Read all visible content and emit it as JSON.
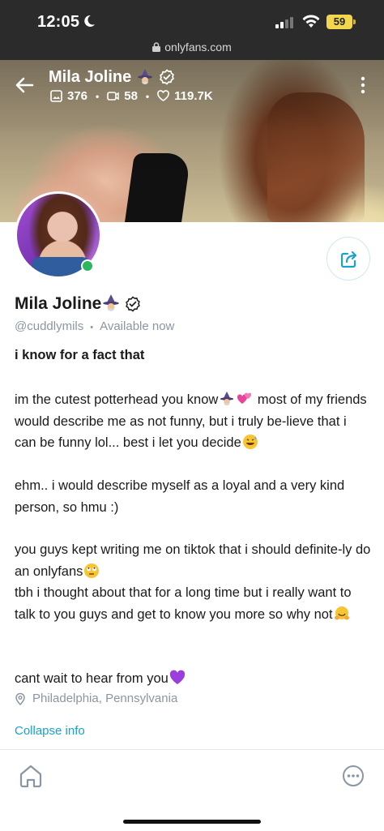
{
  "status": {
    "time": "12:05",
    "battery": "59"
  },
  "browser": {
    "url": "onlyfans.com"
  },
  "header": {
    "name": "Mila Joline",
    "photos": "376",
    "videos": "58",
    "likes": "119.7K"
  },
  "profile": {
    "name": "Mila Joline",
    "handle": "@cuddlymils",
    "availability": "Available now",
    "bio": {
      "line1": "i know for a fact that",
      "p2a": "im the cutest potterhead you know",
      "p2b": " most of my friends would describe me as not funny, but i truly be-lieve that i can be funny lol... best i let you decide",
      "p3": "ehm.. i would describe myself as a loyal and a very kind person, so hmu :)",
      "p4a": "you guys kept writing me on tiktok that i should definite-ly do an onlyfans",
      "p4b": "tbh i thought about that for a long time but i really want to talk to you guys and get to know you more so why not",
      "p5": "cant wait to hear from you"
    },
    "location": "Philadelphia, Pennsylvania",
    "collapse_label": "Collapse info"
  },
  "colors": {
    "accent": "#1aa1cc",
    "online": "#2bb660",
    "muted": "#8a96a3",
    "battery": "#f2d64b"
  },
  "icons": [
    "back-arrow-icon",
    "image-icon",
    "video-icon",
    "heart-icon",
    "verified-icon",
    "more-vertical-icon",
    "share-icon",
    "location-pin-icon",
    "home-icon",
    "more-horizontal-icon"
  ]
}
